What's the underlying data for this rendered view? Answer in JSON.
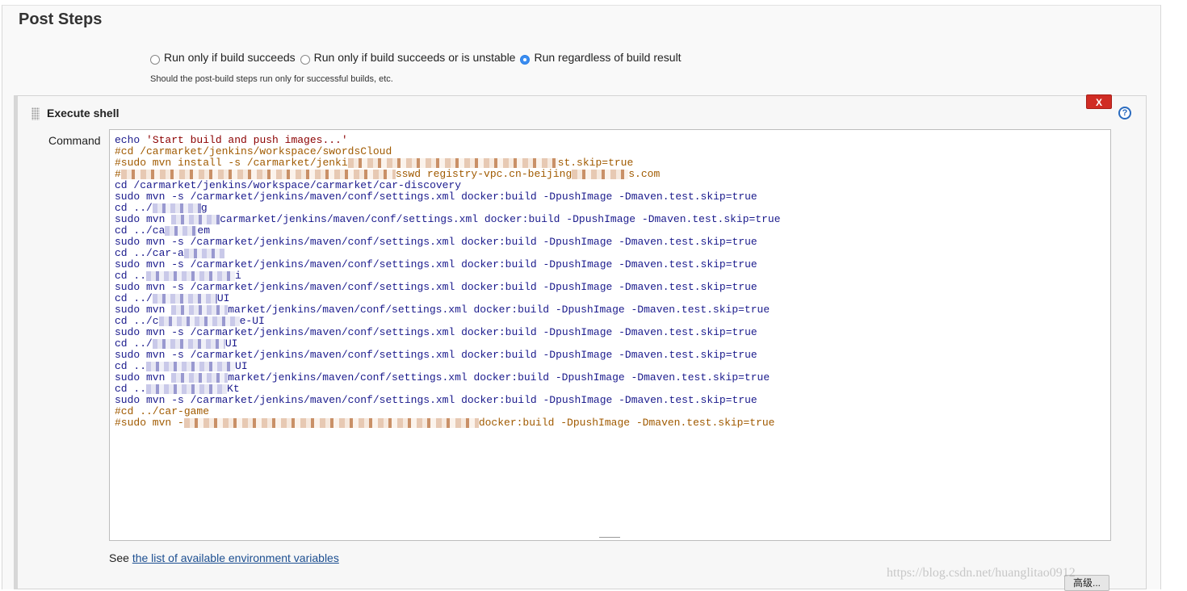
{
  "section": {
    "title": "Post Steps"
  },
  "run_options": [
    {
      "label": "Run only if build succeeds",
      "checked": false
    },
    {
      "label": "Run only if build succeeds or is unstable",
      "checked": false
    },
    {
      "label": "Run regardless of build result",
      "checked": true
    }
  ],
  "run_hint": "Should the post-build steps run only for successful builds, etc.",
  "builder": {
    "title": "Execute shell",
    "delete_label": "X",
    "help_label": "?",
    "command_label": "Command"
  },
  "command_lines": [
    {
      "parts": [
        {
          "t": "echo ",
          "c": "kw"
        },
        {
          "t": "'Start build and push images...'",
          "c": "string"
        }
      ]
    },
    {
      "parts": [
        {
          "t": "#cd /carmarket/jenkins/workspace/swordsCloud",
          "c": "comment"
        }
      ]
    },
    {
      "parts": [
        {
          "t": "#sudo mvn install -s /carmarket/jenki",
          "c": "comment"
        },
        {
          "blur": 260,
          "orange": true
        },
        {
          "t": "st.skip=true",
          "c": "comment"
        }
      ]
    },
    {
      "parts": [
        {
          "t": "#",
          "c": "comment"
        },
        {
          "blur": 340,
          "orange": true
        },
        {
          "t": "sswd registry-vpc.cn-beijing",
          "c": "comment"
        },
        {
          "blur": 70,
          "orange": true
        },
        {
          "t": "s.com",
          "c": "comment"
        }
      ]
    },
    {
      "parts": [
        {
          "t": "cd /carmarket/jenkins/workspace/carmarket/car-discovery",
          "c": "kw"
        }
      ]
    },
    {
      "parts": [
        {
          "t": "sudo mvn -s /carmarket/jenkins/maven/conf/settings.xml docker:build -DpushImage -Dmaven.test.skip=true",
          "c": "kw"
        }
      ]
    },
    {
      "parts": [
        {
          "t": "cd ../",
          "c": "kw"
        },
        {
          "blur": 60
        },
        {
          "t": "g",
          "c": "kw"
        }
      ]
    },
    {
      "parts": [
        {
          "t": "sudo mvn ",
          "c": "kw"
        },
        {
          "blur": 60
        },
        {
          "t": "carmarket/jenkins/maven/conf/settings.xml docker:build -DpushImage -Dmaven.test.skip=true",
          "c": "kw"
        }
      ]
    },
    {
      "parts": [
        {
          "t": "cd ../ca",
          "c": "kw"
        },
        {
          "blur": 40
        },
        {
          "t": "em",
          "c": "kw"
        }
      ]
    },
    {
      "parts": [
        {
          "t": "sudo mvn -s /carmarket/jenkins/maven/conf/settings.xml docker:build -DpushImage -Dmaven.test.skip=true",
          "c": "kw"
        }
      ]
    },
    {
      "parts": [
        {
          "t": "cd ../car-a",
          "c": "kw"
        },
        {
          "blur": 50
        }
      ]
    },
    {
      "parts": [
        {
          "t": "sudo mvn -s /carmarket/jenkins/maven/conf/settings.xml docker:build -DpushImage -Dmaven.test.skip=true",
          "c": "kw"
        }
      ]
    },
    {
      "parts": [
        {
          "t": "cd ..",
          "c": "kw"
        },
        {
          "blur": 110
        },
        {
          "t": "i",
          "c": "kw"
        }
      ]
    },
    {
      "parts": [
        {
          "t": "sudo mvn -s /carmarket/jenkins/maven/conf/settings.xml docker:build -DpushImage -Dmaven.test.skip=true",
          "c": "kw"
        }
      ]
    },
    {
      "parts": [
        {
          "t": "cd ../",
          "c": "kw"
        },
        {
          "blur": 80
        },
        {
          "t": "UI",
          "c": "kw"
        }
      ]
    },
    {
      "parts": [
        {
          "t": "sudo mvn ",
          "c": "kw"
        },
        {
          "blur": 70
        },
        {
          "t": "market/jenkins/maven/conf/settings.xml docker:build -DpushImage -Dmaven.test.skip=true",
          "c": "kw"
        }
      ]
    },
    {
      "parts": [
        {
          "t": "cd ../c",
          "c": "kw"
        },
        {
          "blur": 100
        },
        {
          "t": "e-UI",
          "c": "kw"
        }
      ]
    },
    {
      "parts": [
        {
          "t": "sudo mvn -s /carmarket/jenkins/maven/conf/settings.xml docker:build -DpushImage -Dmaven.test.skip=true",
          "c": "kw"
        }
      ]
    },
    {
      "parts": [
        {
          "t": "cd ../",
          "c": "kw"
        },
        {
          "blur": 90
        },
        {
          "t": "UI",
          "c": "kw"
        }
      ]
    },
    {
      "parts": [
        {
          "t": "sudo mvn -s /carmarket/jenkins/maven/conf/settings.xml docker:build -DpushImage -Dmaven.test.skip=true",
          "c": "kw"
        }
      ]
    },
    {
      "parts": [
        {
          "t": "cd ..",
          "c": "kw"
        },
        {
          "blur": 110
        },
        {
          "t": "UI",
          "c": "kw"
        }
      ]
    },
    {
      "parts": [
        {
          "t": "sudo mvn ",
          "c": "kw"
        },
        {
          "blur": 70
        },
        {
          "t": "market/jenkins/maven/conf/settings.xml docker:build -DpushImage -Dmaven.test.skip=true",
          "c": "kw"
        }
      ]
    },
    {
      "parts": [
        {
          "t": "cd ..",
          "c": "kw"
        },
        {
          "blur": 100
        },
        {
          "t": "Kt",
          "c": "kw"
        }
      ]
    },
    {
      "parts": [
        {
          "t": "sudo mvn -s /carmarket/jenkins/maven/conf/settings.xml docker:build -DpushImage -Dmaven.test.skip=true",
          "c": "kw"
        }
      ]
    },
    {
      "parts": [
        {
          "t": "#cd ../car-game",
          "c": "comment"
        }
      ]
    },
    {
      "parts": [
        {
          "t": "#sudo mvn -",
          "c": "comment"
        },
        {
          "blur": 365,
          "orange": true
        },
        {
          "t": "docker:build -DpushImage -Dmaven.test.skip=true",
          "c": "comment"
        }
      ]
    }
  ],
  "env": {
    "prefix": "See ",
    "link_text": "the list of available environment variables"
  },
  "advanced_button": "高级...",
  "watermark": "https://blog.csdn.net/huanglitao0912"
}
